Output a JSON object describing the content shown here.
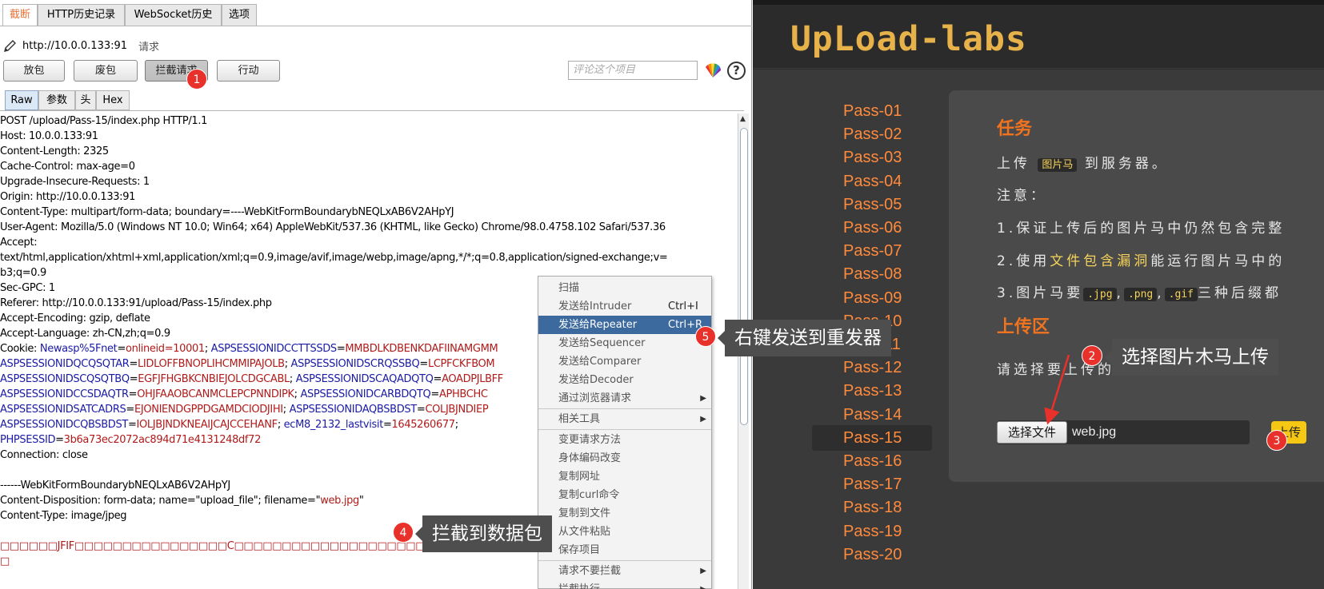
{
  "burp": {
    "tabs": [
      "截断",
      "HTTP历史记录",
      "WebSocket历史",
      "选项"
    ],
    "url": "http://10.0.0.133:91",
    "request_label": "请求",
    "buttons": {
      "forward": "放包",
      "drop": "废包",
      "intercept": "拦截请求",
      "action": "行动"
    },
    "comment_placeholder": "评论这个项目",
    "help": "?",
    "subtabs": [
      "Raw",
      "参数",
      "头",
      "Hex"
    ],
    "request_lines": [
      "POST /upload/Pass-15/index.php HTTP/1.1",
      "Host: 10.0.0.133:91",
      "Content-Length: 2325",
      "Cache-Control: max-age=0",
      "Upgrade-Insecure-Requests: 1",
      "Origin: http://10.0.0.133:91",
      "Content-Type: multipart/form-data; boundary=----WebKitFormBoundarybNEQLxAB6V2AHpYJ",
      "User-Agent: Mozilla/5.0 (Windows NT 10.0; Win64; x64) AppleWebKit/537.36 (KHTML, like Gecko) Chrome/98.0.4758.102 Safari/537.36",
      "Accept:",
      "text/html,application/xhtml+xml,application/xml;q=0.9,image/avif,image/webp,image/apng,*/*;q=0.8,application/signed-exchange;v=",
      "b3;q=0.9",
      "Sec-GPC: 1",
      "Referer: http://10.0.0.133:91/upload/Pass-15/index.php",
      "Accept-Encoding: gzip, deflate",
      "Accept-Language: zh-CN,zh;q=0.9"
    ],
    "cookie_lines": [
      [
        {
          "t": "Cookie: ",
          "c": ""
        },
        {
          "t": "Newasp%5Fnet",
          "c": "k"
        },
        {
          "t": "=",
          "c": ""
        },
        {
          "t": "onlineid=10001",
          "c": "v"
        },
        {
          "t": "; ",
          "c": ""
        },
        {
          "t": "ASPSESSIONIDCCTTSSDS",
          "c": "k"
        },
        {
          "t": "=",
          "c": ""
        },
        {
          "t": "MMBDLKDBENKDAFIINAMGMM",
          "c": "v"
        }
      ],
      [
        {
          "t": "ASPSESSIONIDQCQSQTAR",
          "c": "k"
        },
        {
          "t": "=",
          "c": ""
        },
        {
          "t": "LIDLOFFBNOPLIHCMMIPAJOLB",
          "c": "v"
        },
        {
          "t": "; ",
          "c": ""
        },
        {
          "t": "ASPSESSIONIDSCRQSSBQ",
          "c": "k"
        },
        {
          "t": "=",
          "c": ""
        },
        {
          "t": "LCPFCKFBOM",
          "c": "v"
        }
      ],
      [
        {
          "t": "ASPSESSIONIDSCQSQTBQ",
          "c": "k"
        },
        {
          "t": "=",
          "c": ""
        },
        {
          "t": "EGFJFHGBKCNBIEJOLCDGCABL",
          "c": "v"
        },
        {
          "t": "; ",
          "c": ""
        },
        {
          "t": "ASPSESSIONIDSCAQADQTQ",
          "c": "k"
        },
        {
          "t": "=",
          "c": ""
        },
        {
          "t": "AOADPJLBFF",
          "c": "v"
        }
      ],
      [
        {
          "t": "ASPSESSIONIDCCSDAQTR",
          "c": "k"
        },
        {
          "t": "=",
          "c": ""
        },
        {
          "t": "OHJFAAOBCANMCLEPCPNNDIPK",
          "c": "v"
        },
        {
          "t": "; ",
          "c": ""
        },
        {
          "t": "ASPSESSIONIDCARBDQTQ",
          "c": "k"
        },
        {
          "t": "=",
          "c": ""
        },
        {
          "t": "APHBCHC",
          "c": "v"
        }
      ],
      [
        {
          "t": "ASPSESSIONIDSATCADRS",
          "c": "k"
        },
        {
          "t": "=",
          "c": ""
        },
        {
          "t": "EJONIENDGPPDGAMDCIODJIHI",
          "c": "v"
        },
        {
          "t": "; ",
          "c": ""
        },
        {
          "t": "ASPSESSIONIDAQBSBDST",
          "c": "k"
        },
        {
          "t": "=",
          "c": ""
        },
        {
          "t": "COLJBJNDIEP",
          "c": "v"
        }
      ],
      [
        {
          "t": "ASPSESSIONIDCQBSBDST",
          "c": "k"
        },
        {
          "t": "=",
          "c": ""
        },
        {
          "t": "IOLJBJNDKNEAIJCAJCCEHANF",
          "c": "v"
        },
        {
          "t": "; ",
          "c": ""
        },
        {
          "t": "ecM8_2132_lastvisit",
          "c": "k"
        },
        {
          "t": "=",
          "c": ""
        },
        {
          "t": "1645260677",
          "c": "v"
        },
        {
          "t": ";",
          "c": ""
        }
      ],
      [
        {
          "t": "PHPSESSID",
          "c": "k"
        },
        {
          "t": "=",
          "c": ""
        },
        {
          "t": "3b6a73ec2072ac894d71e4131248df72",
          "c": "v"
        }
      ]
    ],
    "tail_lines": [
      {
        "t": "Connection: close",
        "c": ""
      },
      {
        "t": "",
        "c": ""
      },
      {
        "t": "------WebKitFormBoundarybNEQLxAB6V2AHpYJ",
        "c": ""
      },
      {
        "t": "Content-Disposition: form-data; name=\"upload_file\"; filename=\"",
        "c": "",
        "v": "web.jpg",
        "end": "\""
      },
      {
        "t": "Content-Type: image/jpeg",
        "c": ""
      },
      {
        "t": "",
        "c": ""
      },
      {
        "t": "□□□□□□JFIF□□□□□□□□□□□□□□□□C□□□□□□□□□□□□□□□□□□□□",
        "c": "v"
      },
      {
        "t": "□",
        "c": "v"
      }
    ],
    "context_menu": {
      "items": [
        {
          "label": "扫描"
        },
        {
          "label": "发送给Intruder",
          "shortcut": "Ctrl+I"
        },
        {
          "label": "发送给Repeater",
          "shortcut": "Ctrl+R",
          "highlight": true
        },
        {
          "label": "发送给Sequencer"
        },
        {
          "label": "发送给Comparer"
        },
        {
          "label": "发送给Decoder"
        },
        {
          "label": "通过浏览器请求",
          "submenu": true
        },
        {
          "sep": true
        },
        {
          "label": "相关工具",
          "submenu": true
        },
        {
          "sep": true
        },
        {
          "label": "变更请求方法"
        },
        {
          "label": "身体编码改变"
        },
        {
          "label": "复制网址"
        },
        {
          "label": "复制curl命令"
        },
        {
          "label": "复制到文件"
        },
        {
          "label": "从文件粘贴"
        },
        {
          "label": "保存项目"
        },
        {
          "sep": true
        },
        {
          "label": "请求不要拦截",
          "submenu": true
        },
        {
          "label": "拦截执行",
          "submenu": true
        }
      ]
    }
  },
  "annotations": {
    "n1": "1",
    "n2": "2",
    "n3": "3",
    "n4": "4",
    "n5": "5",
    "c2": "选择图片木马上传",
    "c4": "拦截到数据包",
    "c5": "右键发送到重发器"
  },
  "site": {
    "logo": "UpLoad-labs",
    "nav": [
      "Pass-01",
      "Pass-02",
      "Pass-03",
      "Pass-04",
      "Pass-05",
      "Pass-06",
      "Pass-07",
      "Pass-08",
      "Pass-09",
      "Pass-10",
      "Pass-11",
      "Pass-12",
      "Pass-13",
      "Pass-14",
      "Pass-15",
      "Pass-16",
      "Pass-17",
      "Pass-18",
      "Pass-19",
      "Pass-20"
    ],
    "selected": "Pass-15",
    "task_title": "任务",
    "task_pre": "上传",
    "task_code": "图片马",
    "task_post": "到服务器。",
    "note": "注意：",
    "l1": "1.保证上传后的图片马中仍然包含完整",
    "l2_pre": "2.使用",
    "l2_link": "文件包含漏洞",
    "l2_post": "能运行图片马中的",
    "l3_pre": "3.图片马要",
    "l3_c1": ".jpg",
    "l3_c2": ".png",
    "l3_c3": ".gif",
    "l3_post": "三种后缀都",
    "upload_title": "上传区",
    "choose_prompt": "请选择要上传的图片：",
    "choose_btn": "选择文件",
    "filename": "web.jpg",
    "upload_btn": "上传"
  }
}
